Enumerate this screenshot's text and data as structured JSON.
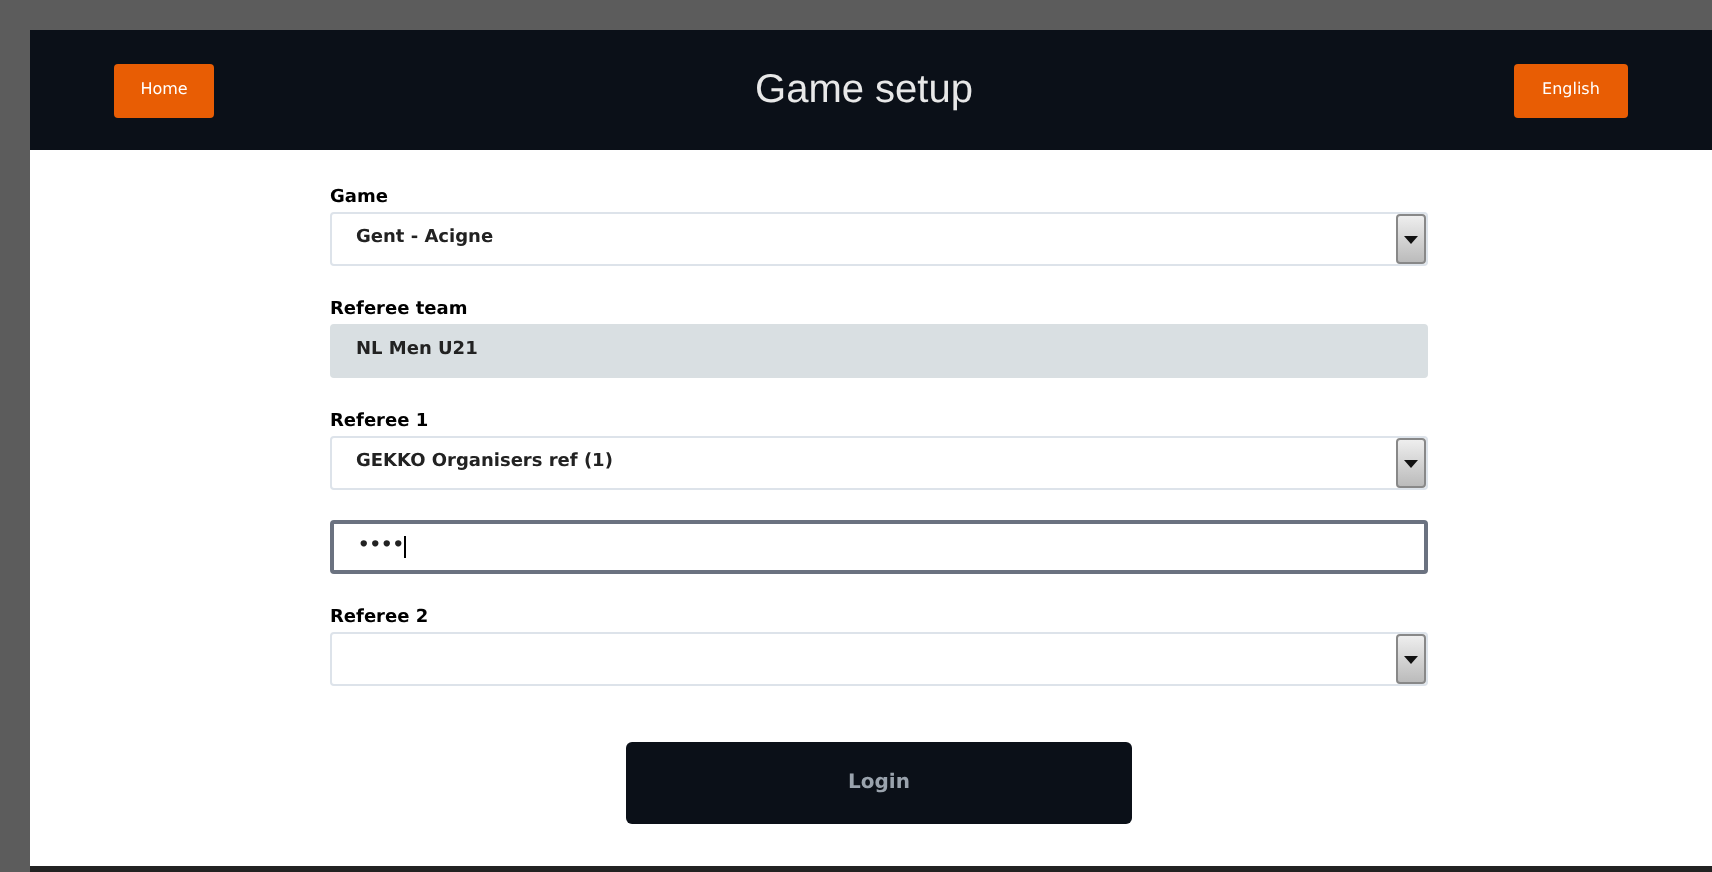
{
  "header": {
    "title": "Game setup",
    "home_button": "Home",
    "language_button": "English"
  },
  "fields": [
    {
      "kind": "select",
      "label": "Game",
      "value": "Gent - Acigne"
    },
    {
      "kind": "readonly",
      "label": "Referee team",
      "value": "NL Men U21"
    },
    {
      "kind": "select",
      "label": "Referee 1",
      "value": "GEKKO Organisers ref (1)"
    },
    {
      "kind": "password",
      "value": "••••",
      "focused": true
    },
    {
      "kind": "select",
      "label": "Referee 2"
    }
  ],
  "login_button": "Login"
}
